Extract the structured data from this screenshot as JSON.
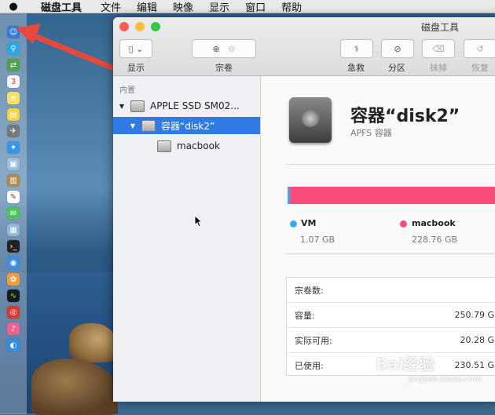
{
  "menubar": {
    "apple": "",
    "items": [
      "磁盘工具",
      "文件",
      "编辑",
      "映像",
      "显示",
      "窗口",
      "帮助"
    ]
  },
  "window": {
    "title": "磁盘工具",
    "toolbar": {
      "show_label": "显示",
      "volume_label": "宗卷",
      "firstaid_label": "急救",
      "partition_label": "分区",
      "erase_label": "抹掉",
      "restore_label": "恢复"
    }
  },
  "sidebar": {
    "section": "内置",
    "items": [
      {
        "label": "APPLE SSD SM02..."
      },
      {
        "label": "容器“disk2”"
      },
      {
        "label": "macbook"
      }
    ]
  },
  "main": {
    "volume_name": "容器“disk2”",
    "volume_type": "APFS 容器",
    "legend": [
      {
        "name": "VM",
        "size": "1.07 GB",
        "color": "#33aee8"
      },
      {
        "name": "macbook",
        "size": "228.76 GB",
        "color": "#fb4b7a"
      }
    ],
    "usage": {
      "vm_fraction": 0.005
    },
    "info": [
      {
        "label": "宗卷数:",
        "value": ""
      },
      {
        "label": "容量:",
        "value": "250.79 G"
      },
      {
        "label": "实际可用:",
        "value": "20.28 G"
      },
      {
        "label": "已使用:",
        "value": "230.51 G"
      }
    ]
  },
  "watermark": {
    "main": "Bai经验",
    "sub": "jingyan.baidu.com"
  }
}
